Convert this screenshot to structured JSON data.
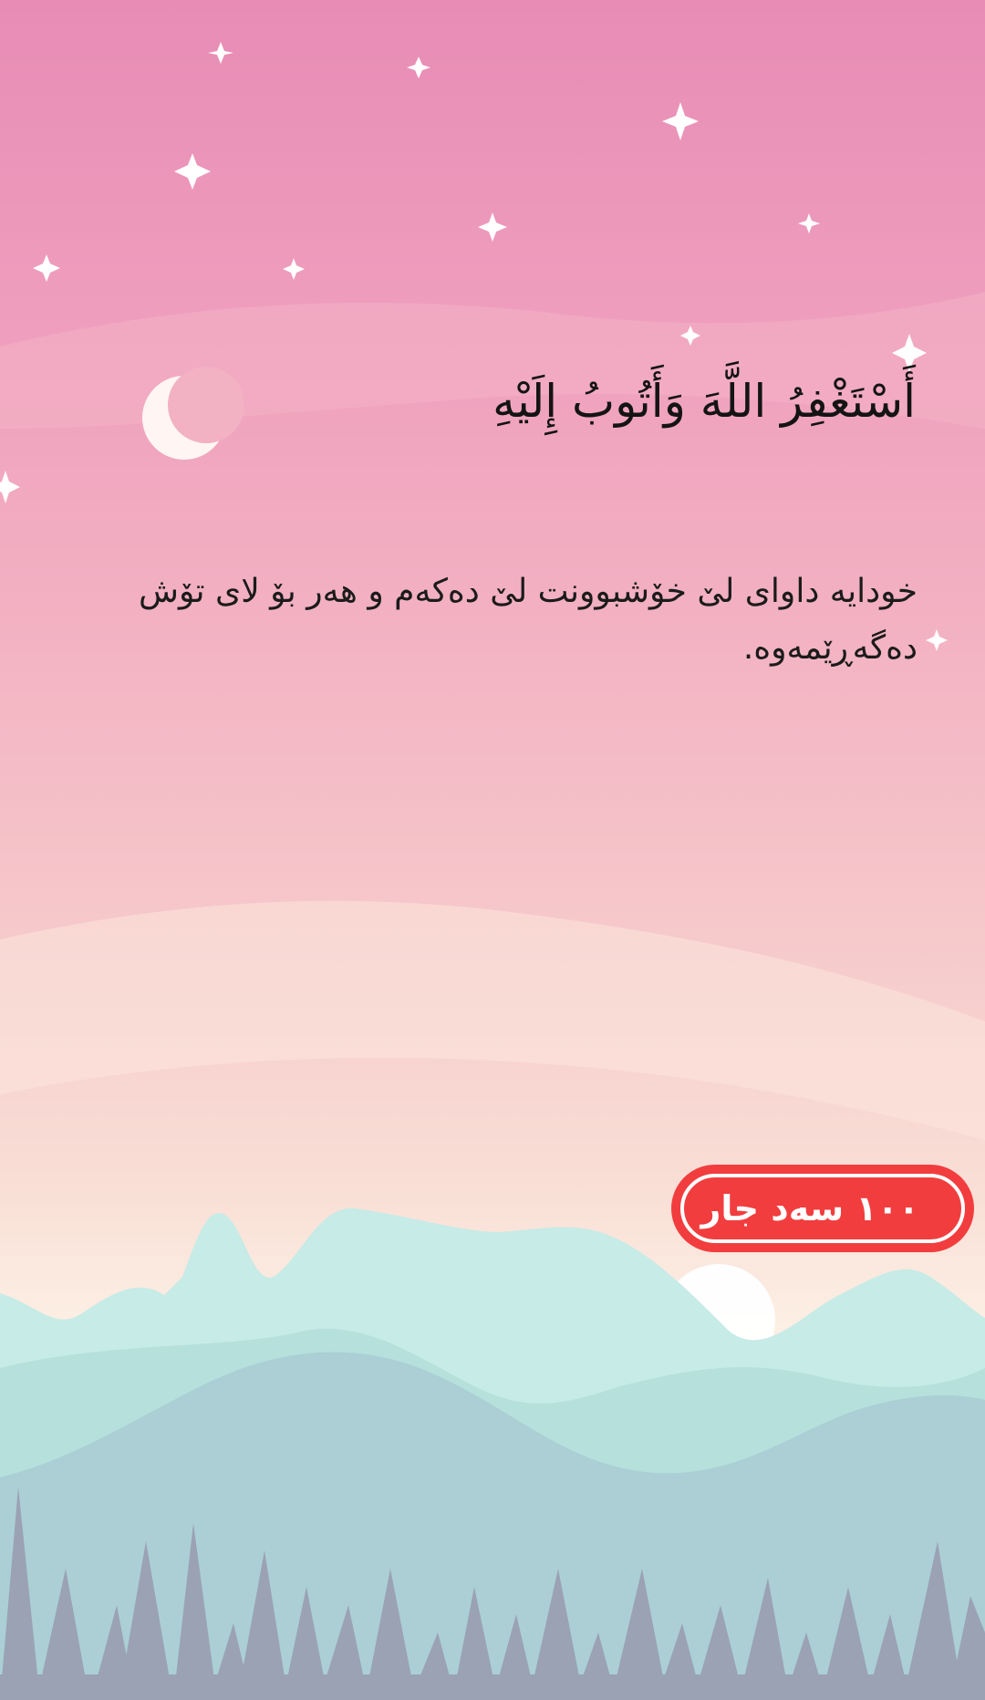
{
  "dhikr": {
    "arabic": "أَسْتَغْفِرُ اللَّهَ وَأَتُوبُ إِلَيْهِ",
    "translation": "خودایە داوای لێ خۆشبوونت لێ دەکەم و هەر بۆ لای تۆش دەگەڕێمەوە."
  },
  "counter": {
    "label": "١٠٠ سەد جار"
  },
  "decor": {
    "icons": [
      "star-icon",
      "crescent-moon-icon",
      "sun-icon"
    ],
    "colors": {
      "sky_top": "#e88cb6",
      "sky_bottom": "#fcefe4",
      "button": "#f23d3f",
      "mountain_near": "#a8e0da",
      "forest": "#9aa7b8"
    }
  }
}
